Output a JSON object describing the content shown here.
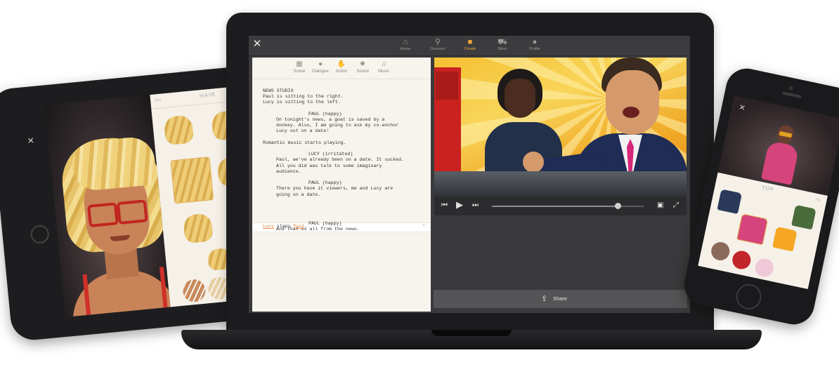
{
  "tablet": {
    "close_icon": "close-icon",
    "hair_panel": {
      "title": "HAIR",
      "back_icon": "arrow-left-icon"
    },
    "hair_color": "#e7c46a",
    "glasses_color": "#c0261f",
    "skin_swatches": [
      "#c98a5a",
      "#e7cfa4",
      "#d8b27a",
      "#f0e2c4"
    ]
  },
  "laptop": {
    "close_label": "✕",
    "nav": [
      {
        "label": "Home",
        "icon": "home-icon",
        "glyph": "⌂",
        "active": false
      },
      {
        "label": "Discover",
        "icon": "search-icon",
        "glyph": "⚲",
        "active": false
      },
      {
        "label": "Create",
        "icon": "camera-icon",
        "glyph": "■",
        "active": true
      },
      {
        "label": "Store",
        "icon": "cart-icon",
        "glyph": "⛟",
        "active": false
      },
      {
        "label": "Profile",
        "icon": "user-icon",
        "glyph": "●",
        "active": false
      }
    ],
    "script_tools": [
      {
        "label": "Scene",
        "icon": "clapperboard-icon",
        "glyph": "▦"
      },
      {
        "label": "Dialogue",
        "icon": "speech-bubble-icon",
        "glyph": "●"
      },
      {
        "label": "Action",
        "icon": "hand-icon",
        "glyph": "✋"
      },
      {
        "label": "Sound",
        "icon": "burst-icon",
        "glyph": "✸"
      },
      {
        "label": "Music",
        "icon": "music-note-icon",
        "glyph": "♫"
      }
    ],
    "script_lines": [
      "NEWS STUDIO",
      "Paul is sitting to the right.",
      "Lucy is sitting to the left.",
      "PAUL (happy)",
      "On tonight's news, a goat is saved by a",
      "donkey. Also, I am going to ask my co-anchor",
      "Lucy out on a date!",
      "Romantic music starts playing.",
      "LUCY (irritated)",
      "Paul, we've already been on a date. It sucked.",
      "All you did was talk to some imaginary",
      "audience.",
      "PAUL (happy)",
      "There you have it viewers, me and Lucy are",
      "going on a date.",
      "PAUL (happy)",
      "And that is all from the news."
    ],
    "highlight_line": {
      "actor": "Lucy",
      "verb": " slaps ",
      "target": "Paul",
      "end": ".",
      "dismiss": "×"
    },
    "player": {
      "prev_icon": "skip-back-icon",
      "play_icon": "play-icon",
      "next_icon": "skip-forward-icon",
      "progress": 0.83,
      "book_icon": "book-icon",
      "fullscreen_icon": "fullscreen-icon"
    },
    "share": {
      "label": "Share",
      "icon": "share-icon"
    }
  },
  "phone": {
    "close_icon": "close-icon",
    "panel_title": "TOP",
    "next_icon": "arrow-right-icon",
    "tops": [
      "#2b3a5a",
      "#d6447c",
      "#f5a623",
      "#4a6b3a"
    ],
    "swatches": [
      "#8a6a5a",
      "#c0262a",
      "#f0c9d9"
    ]
  }
}
